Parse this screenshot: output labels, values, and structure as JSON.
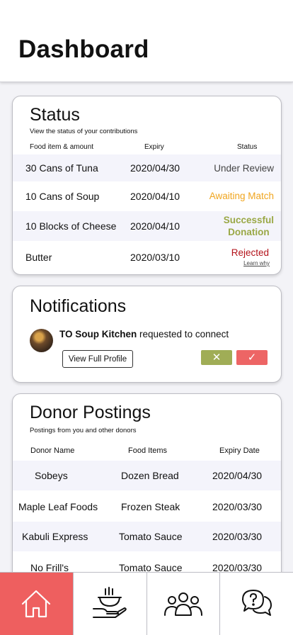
{
  "header": {
    "title": "Dashboard"
  },
  "status": {
    "title": "Status",
    "subtitle": "View the status of your contributions",
    "columns": [
      "Food item & amount",
      "Expiry",
      "Status"
    ],
    "rows": [
      {
        "item": "30 Cans of Tuna",
        "expiry": "2020/04/30",
        "status": "Under Review"
      },
      {
        "item": "10 Cans of Soup",
        "expiry": "2020/04/10",
        "status": "Awaiting Match"
      },
      {
        "item": "10 Blocks of Cheese",
        "expiry": "2020/04/10",
        "status_line1": "Successful",
        "status_line2": "Donation"
      },
      {
        "item": "Butter",
        "expiry": "2020/03/10",
        "status": "Rejected",
        "link": "Learn why"
      }
    ]
  },
  "notifications": {
    "title": "Notifications",
    "org": "TO Soup Kitchen",
    "message": " requested to connect",
    "profile_button": "View Full Profile",
    "decline_symbol": "✕",
    "accept_symbol": "✓"
  },
  "donor": {
    "title": "Donor Postings",
    "subtitle": "Postings from you and other donors",
    "columns": [
      "Donor Name",
      "Food Items",
      "Expiry Date"
    ],
    "rows": [
      {
        "name": "Sobeys",
        "food": "Dozen Bread",
        "expiry": "2020/04/30"
      },
      {
        "name": "Maple Leaf Foods",
        "food": "Frozen Steak",
        "expiry": "2020/03/30"
      },
      {
        "name": "Kabuli Express",
        "food": "Tomato Sauce",
        "expiry": "2020/03/30"
      },
      {
        "name": "No Frill's",
        "food": "Tomato Sauce",
        "expiry": "2020/03/30"
      }
    ]
  },
  "nav": {
    "items": [
      {
        "icon": "home-icon",
        "active": true
      },
      {
        "icon": "food-donation-icon",
        "active": false
      },
      {
        "icon": "community-icon",
        "active": false
      },
      {
        "icon": "help-chat-icon",
        "active": false
      }
    ]
  },
  "colors": {
    "accent": "#ee5f5f",
    "awaiting": "#f0a51e",
    "success": "#9aa846",
    "rejected": "#b3121a"
  }
}
